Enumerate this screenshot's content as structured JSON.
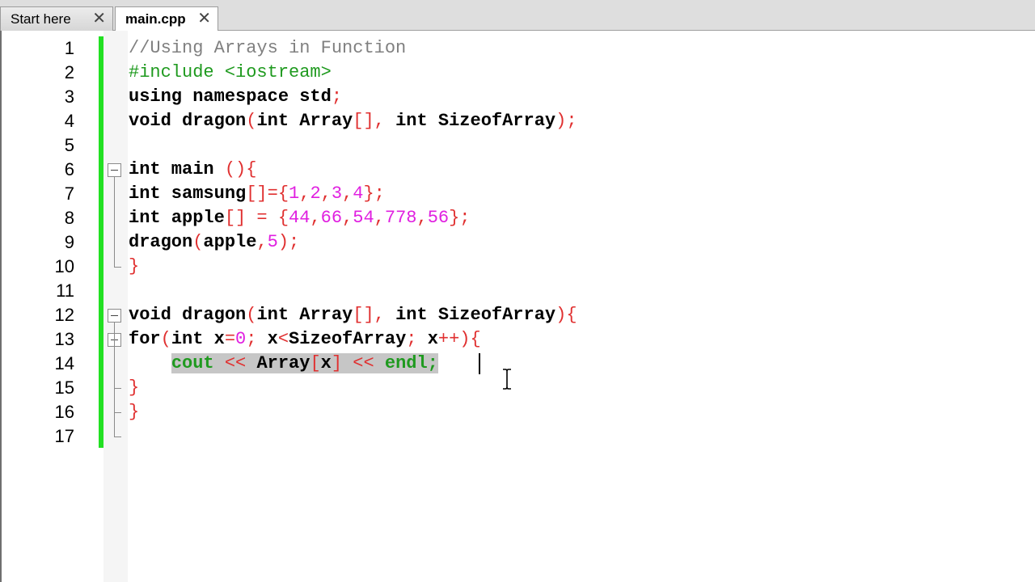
{
  "tabs": [
    {
      "label": "Start here",
      "close": "✕",
      "active": false
    },
    {
      "label": "main.cpp",
      "close": "✕",
      "active": true
    }
  ],
  "line_numbers": [
    "1",
    "2",
    "3",
    "4",
    "5",
    "6",
    "7",
    "8",
    "9",
    "10",
    "11",
    "12",
    "13",
    "14",
    "15",
    "16",
    "17"
  ],
  "code": {
    "l1": "//Using Arrays in Function",
    "l2": "#include <iostream>",
    "l3": {
      "a": "using namespace std",
      "b": ";"
    },
    "l4": {
      "a": "void dragon",
      "b": "(",
      "c": "int Array",
      "d": "[]",
      "e": ", ",
      "f": "int SizeofArray",
      "g": ");"
    },
    "l6": {
      "a": "int main ",
      "b": "(){"
    },
    "l7": {
      "a": "int samsung",
      "b": "[]={",
      "c": "1",
      "d": ",",
      "e": "2",
      "f": ",",
      "g": "3",
      "h": ",",
      "i": "4",
      "j": "};"
    },
    "l8": {
      "a": "int apple",
      "b": "[] = {",
      "c": "44",
      "d": ",",
      "e": "66",
      "f": ",",
      "g": "54",
      "h": ",",
      "i": "778",
      "j": ",",
      "k": "56",
      "l": "};"
    },
    "l9": {
      "a": "dragon",
      "b": "(",
      "c": "apple",
      "d": ",",
      "e": "5",
      "f": ");"
    },
    "l10": "}",
    "l12": {
      "a": "void dragon",
      "b": "(",
      "c": "int Array",
      "d": "[]",
      "e": ", ",
      "f": "int SizeofArray",
      "g": "){"
    },
    "l13": {
      "a": "for",
      "b": "(",
      "c": "int x",
      "d": "=",
      "e": "0",
      "f": "; ",
      "g": "x",
      "h": "<",
      "i": "SizeofArray",
      "j": "; ",
      "k": "x",
      "l": "++){"
    },
    "l14": {
      "indent": "    ",
      "a": "cout",
      "b": " << ",
      "c": "Array",
      "d": "[",
      "e": "x",
      "f": "]",
      "g": " << ",
      "h": "endl;"
    },
    "l15": "}",
    "l16": "}"
  },
  "colors": {
    "change_bar": "#22e022",
    "keyword": "#000000",
    "operator": "#e03030",
    "number": "#e020e0",
    "comment": "#808080",
    "preprocessor": "#1f9a1f",
    "selection": "#c6c6c6"
  }
}
